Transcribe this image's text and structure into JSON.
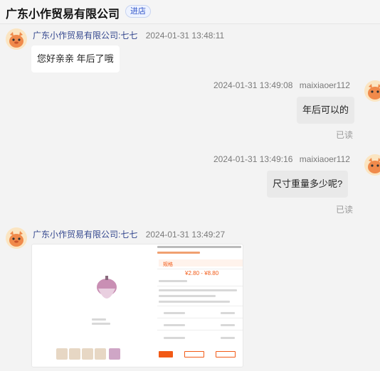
{
  "header": {
    "shop_name": "广东小作贸易有限公司",
    "enter_label": "进店"
  },
  "messages": [
    {
      "side": "left",
      "nick": "广东小作贸易有限公司:七七",
      "time": "2024-01-31 13:48:11",
      "text": "您好亲亲 年后了哦"
    },
    {
      "side": "right",
      "nick": "maixiaoer112",
      "time": "2024-01-31 13:49:08",
      "text": "年后可以的",
      "status": "已读"
    },
    {
      "side": "right",
      "nick": "maixiaoer112",
      "time": "2024-01-31 13:49:16",
      "text": "尺寸重量多少呢?",
      "status": "已读"
    },
    {
      "side": "left",
      "nick": "广东小作贸易有限公司:七七",
      "time": "2024-01-31 13:49:27",
      "image": "product-screenshot"
    }
  ],
  "screenshot": {
    "tab": "规格",
    "price": "¥2.80 - ¥8.80"
  },
  "colors": {
    "accent": "#f25a16",
    "nick": "#35488f",
    "link": "#2f54c8"
  }
}
